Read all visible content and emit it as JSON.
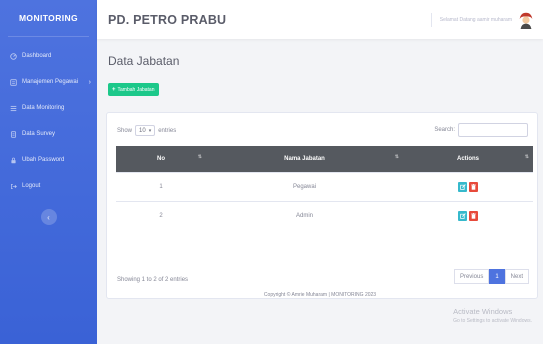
{
  "sidebar": {
    "brand": "MONITORING",
    "items": [
      {
        "label": "Dashboard",
        "icon": "dashboard-icon"
      },
      {
        "label": "Manajemen Pegawai",
        "icon": "users-icon",
        "has_submenu": true
      },
      {
        "label": "Data Monitoring",
        "icon": "list-icon"
      },
      {
        "label": "Data Survey",
        "icon": "survey-icon"
      },
      {
        "label": "Ubah Password",
        "icon": "lock-icon"
      },
      {
        "label": "Logout",
        "icon": "logout-icon"
      }
    ],
    "toggle_icon": "chevron-left-icon"
  },
  "topbar": {
    "company": "PD. PETRO PRABU",
    "greeting": "Selamat Datang aamir muharam"
  },
  "main": {
    "title": "Data Jabatan",
    "add_button": "Tambah Jabatan"
  },
  "table_controls": {
    "show_label": "Show",
    "page_length": "10",
    "entries_label": "entries",
    "search_label": "Search:",
    "search_value": ""
  },
  "table": {
    "columns": [
      "No",
      "Nama Jabatan",
      "Actions"
    ],
    "rows": [
      {
        "no": "1",
        "name": "Pegawai"
      },
      {
        "no": "2",
        "name": "Admin"
      }
    ]
  },
  "pagination": {
    "info": "Showing 1 to 2 of 2 entries",
    "previous": "Previous",
    "current": "1",
    "next": "Next"
  },
  "footer": {
    "copyright": "Copyright © Amrie Muharam | MONITORING 2023"
  },
  "activation": {
    "title": "Activate Windows",
    "subtitle": "Go to Settings to activate Windows."
  },
  "colors": {
    "sidebar": "#4e73df",
    "success": "#1cc88a",
    "info": "#36b9cc",
    "danger": "#e74a3b",
    "table_header": "#55595f"
  }
}
